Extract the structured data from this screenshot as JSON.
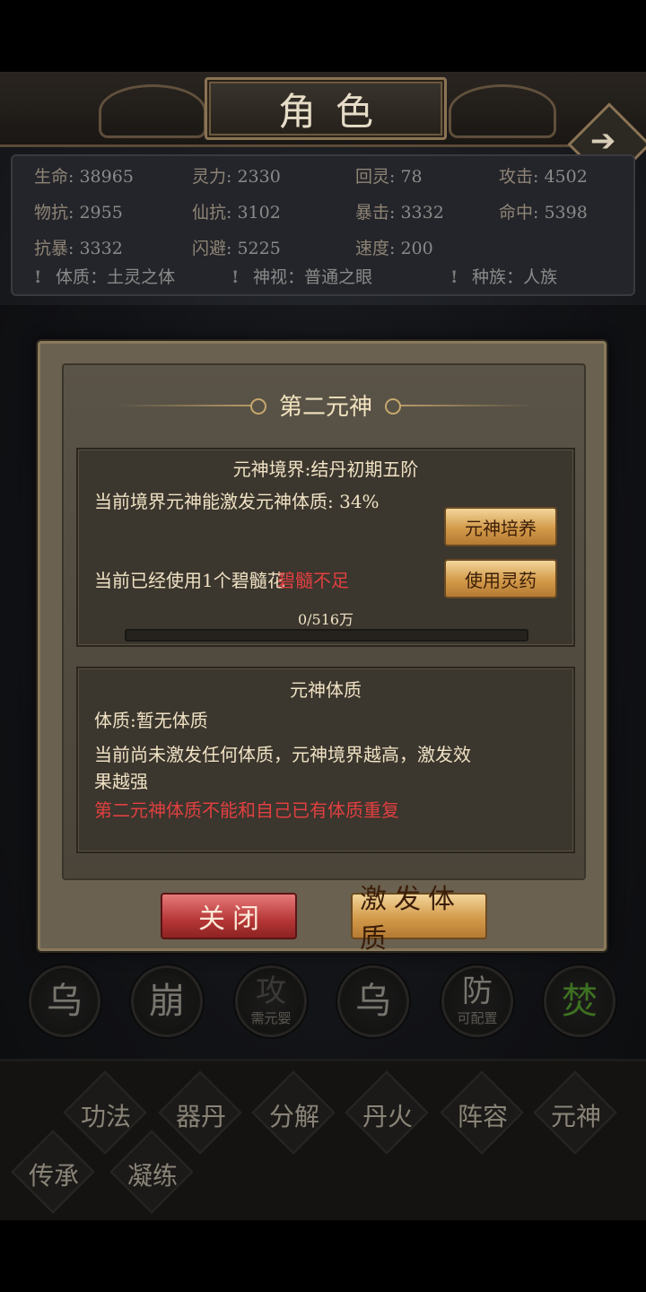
{
  "header": {
    "title": "角色",
    "next_icon": "arrow-right-icon"
  },
  "stats": {
    "rows": [
      [
        {
          "k": "生命",
          "v": "38965"
        },
        {
          "k": "灵力",
          "v": "2330"
        },
        {
          "k": "回灵",
          "v": "78"
        },
        {
          "k": "攻击",
          "v": "4502"
        }
      ],
      [
        {
          "k": "物抗",
          "v": "2955"
        },
        {
          "k": "仙抗",
          "v": "3102"
        },
        {
          "k": "暴击",
          "v": "3332"
        },
        {
          "k": "命中",
          "v": "5398"
        }
      ],
      [
        {
          "k": "抗暴",
          "v": "3332"
        },
        {
          "k": "闪避",
          "v": "5225"
        },
        {
          "k": "速度",
          "v": "200"
        }
      ]
    ],
    "tags": [
      {
        "k": "体质",
        "v": "土灵之体"
      },
      {
        "k": "神视",
        "v": "普通之眼"
      },
      {
        "k": "种族",
        "v": "人族"
      }
    ]
  },
  "modal": {
    "title": "第二元神",
    "realm": {
      "heading": "元神境界:结丹初期五阶",
      "activate_rate": "当前境界元神能激发元神体质: 34%",
      "cultivate_btn": "元神培养",
      "used_text": "当前已经使用1个碧髓花",
      "insufficient": "碧髓不足",
      "use_medicine_btn": "使用灵药",
      "progress_text": "0/516万",
      "progress": 0
    },
    "constitution": {
      "heading": "元神体质",
      "current": "体质:暂无体质",
      "desc_line1": "当前尚未激发任何体质，元神境界越高，激发效",
      "desc_line2": "果越强",
      "warning": "第二元神体质不能和自己已有体质重复"
    },
    "close_btn": "关闭",
    "activate_btn": "激发体质"
  },
  "skills": [
    {
      "char": "乌",
      "sub": "",
      "state": "normal"
    },
    {
      "char": "崩",
      "sub": "",
      "state": "normal"
    },
    {
      "char": "攻",
      "sub": "需元婴",
      "state": "locked"
    },
    {
      "char": "乌",
      "sub": "",
      "state": "normal"
    },
    {
      "char": "防",
      "sub": "可配置",
      "state": "normal"
    },
    {
      "char": "焚",
      "sub": "",
      "state": "active"
    }
  ],
  "menu": {
    "row1": [
      "功法",
      "器丹",
      "分解",
      "丹火",
      "阵容",
      "元神"
    ],
    "row2": [
      "传承",
      "凝练"
    ]
  }
}
